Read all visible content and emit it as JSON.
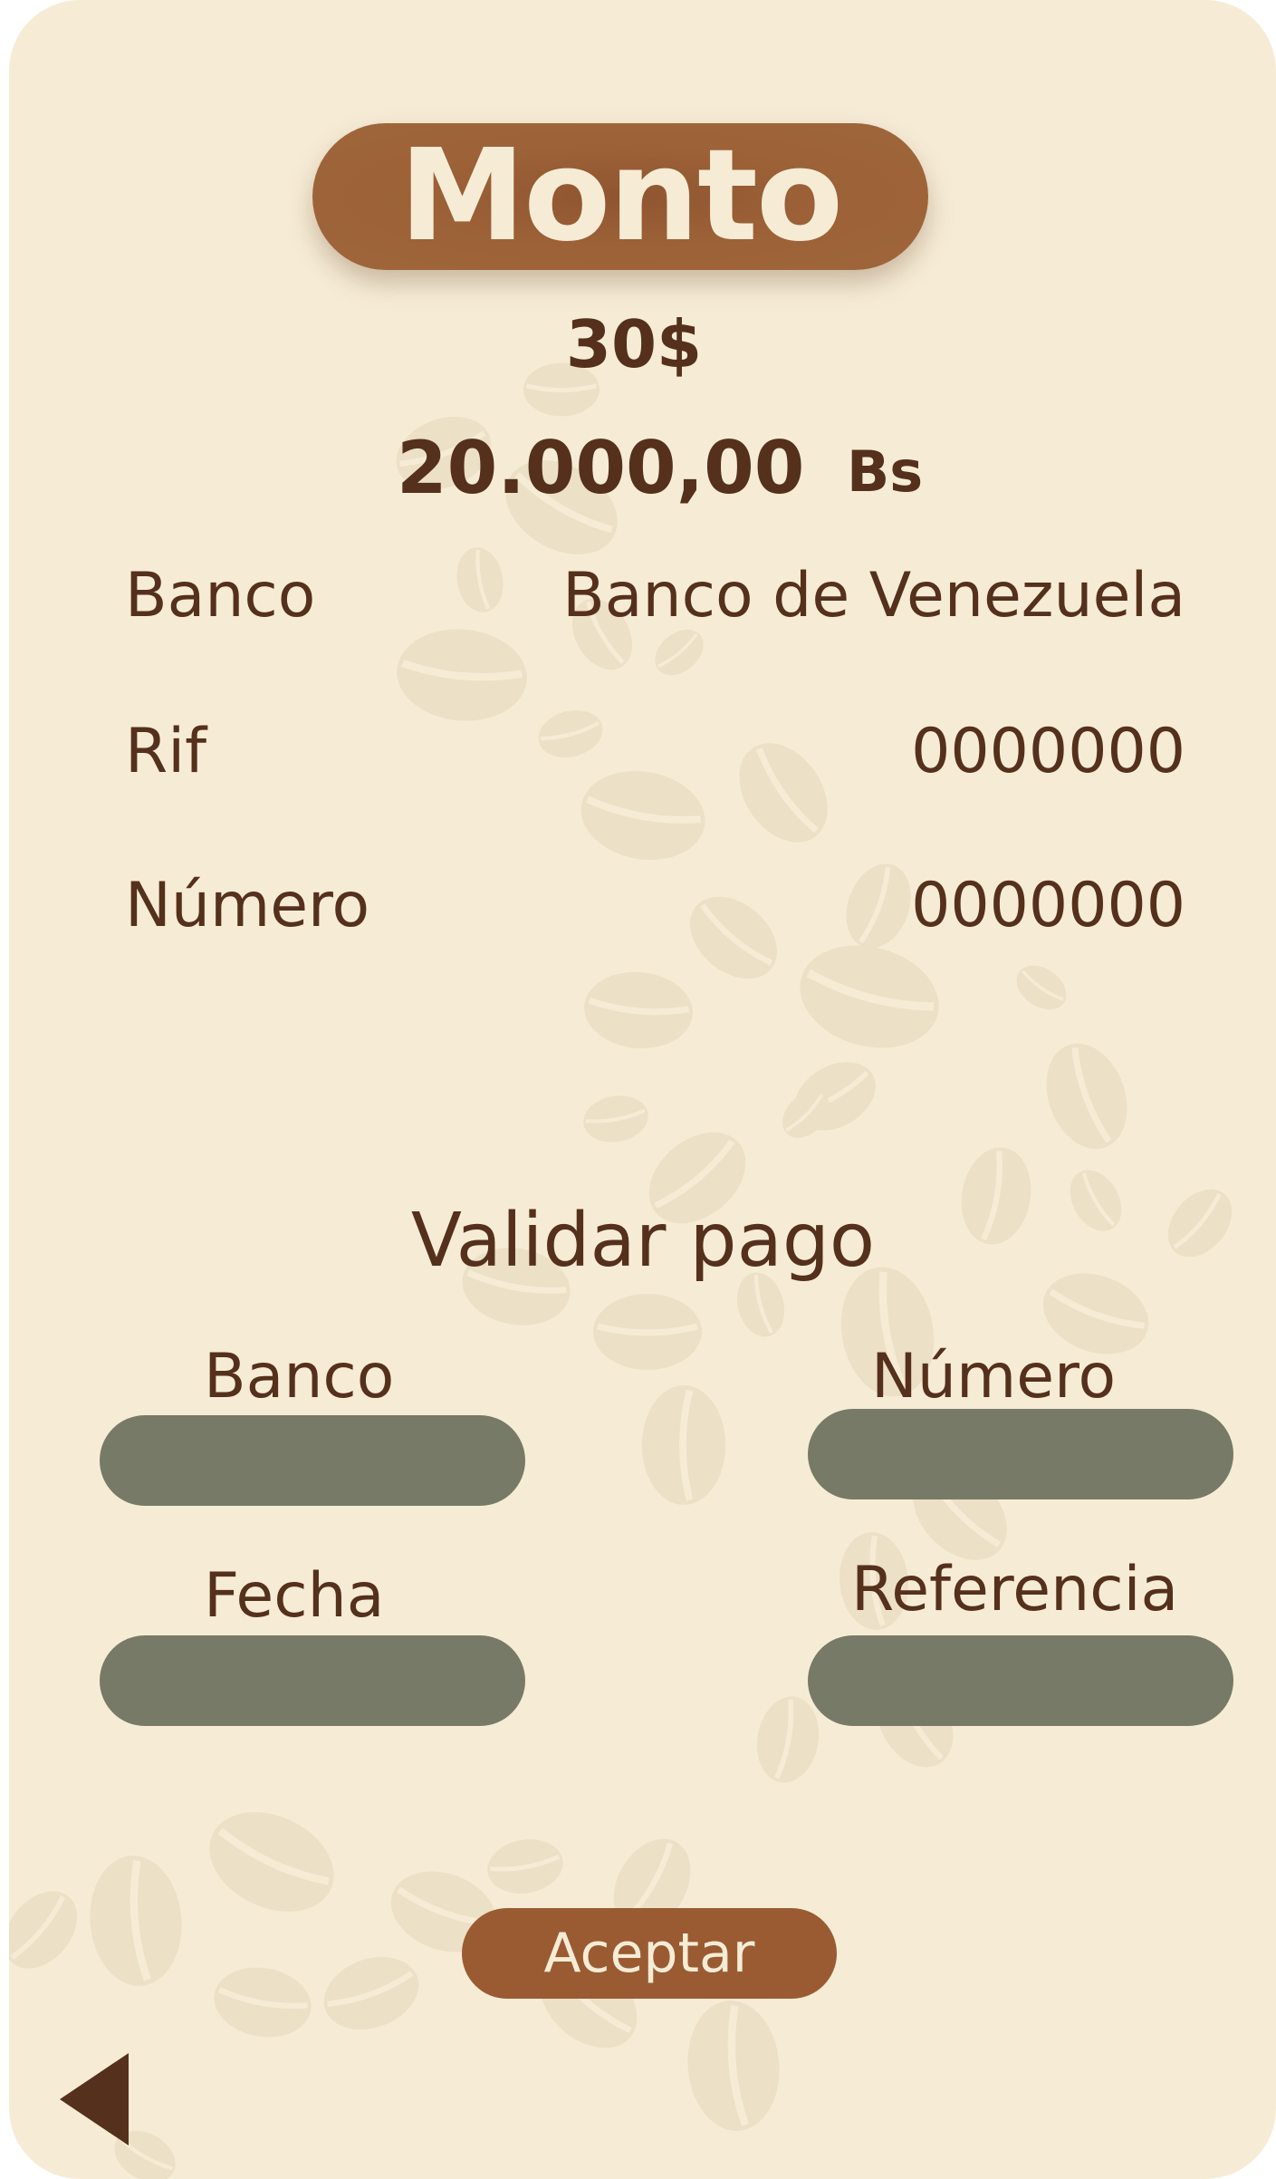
{
  "header": {
    "title": "Monto"
  },
  "amount": {
    "usd": "30$",
    "bs_value": "20.000,00",
    "bs_unit": "Bs"
  },
  "payment_info": [
    {
      "label": "Banco",
      "value": "Banco de Venezuela"
    },
    {
      "label": "Rif",
      "value": "0000000"
    },
    {
      "label": "Número",
      "value": "0000000"
    }
  ],
  "validation": {
    "title": "Validar pago",
    "fields": {
      "bank": {
        "label": "Banco",
        "value": ""
      },
      "number": {
        "label": "Número",
        "value": ""
      },
      "date": {
        "label": "Fecha",
        "value": ""
      },
      "reference": {
        "label": "Referencia",
        "value": ""
      }
    }
  },
  "actions": {
    "accept_label": "Aceptar",
    "back_icon": "back-triangle-icon"
  },
  "colors": {
    "background": "#f6ecd6",
    "accent_brown": "#9a5b33",
    "text_brown": "#55301c",
    "input_gray": "#777a66",
    "bean_pattern": "#ece0c6"
  }
}
